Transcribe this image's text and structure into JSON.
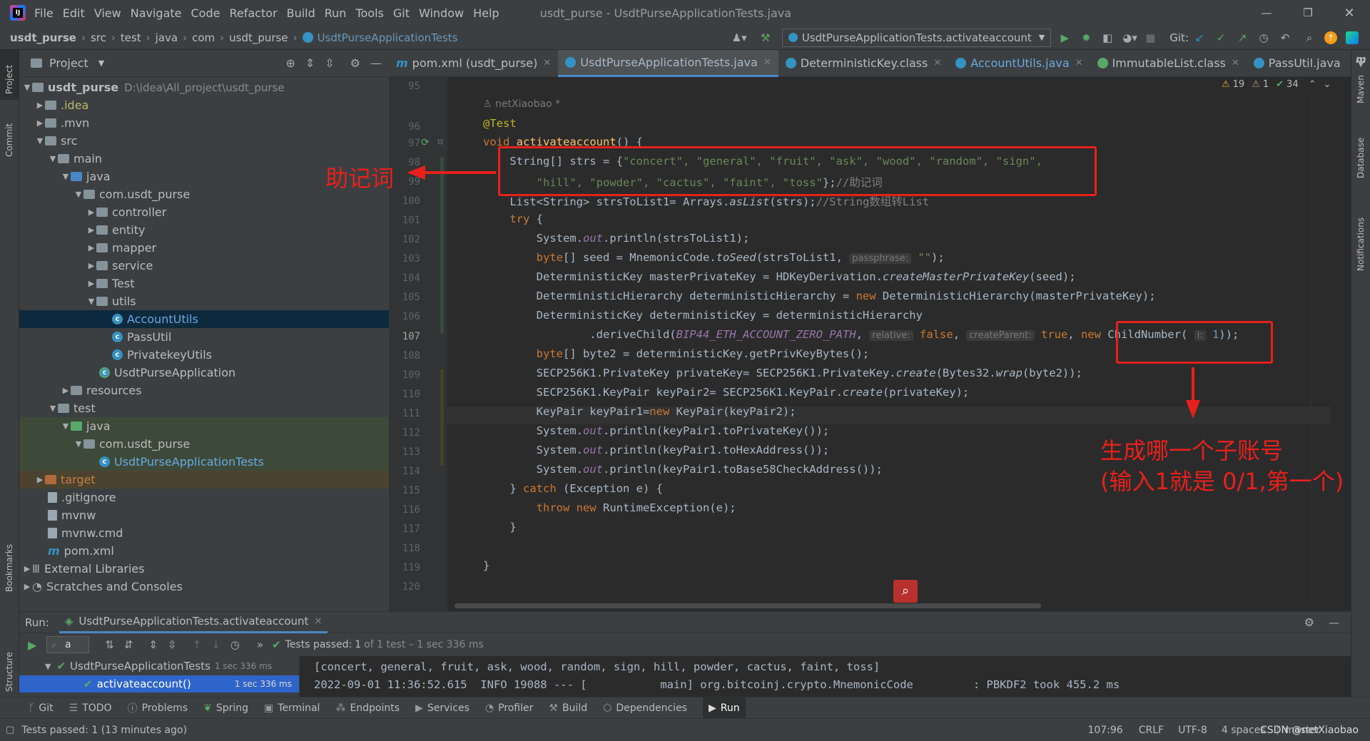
{
  "window": {
    "title": "usdt_purse - UsdtPurseApplicationTests.java"
  },
  "menu": [
    "File",
    "Edit",
    "View",
    "Navigate",
    "Code",
    "Refactor",
    "Build",
    "Run",
    "Tools",
    "Git",
    "Window",
    "Help"
  ],
  "breadcrumb": [
    "usdt_purse",
    "src",
    "test",
    "java",
    "com",
    "usdt_purse",
    "UsdtPurseApplicationTests"
  ],
  "run_config": "UsdtPurseApplicationTests.activateaccount",
  "git_label": "Git:",
  "left_strip": {
    "project": "Project",
    "commit": "Commit",
    "bookmarks": "Bookmarks",
    "structure": "Structure"
  },
  "right_strip": {
    "maven": "Maven",
    "database": "Database",
    "notifications": "Notifications"
  },
  "project_panel": {
    "title": "Project",
    "tree": [
      {
        "label": "usdt_purse",
        "extra": "D:\\idea\\All_project\\usdt_purse"
      },
      {
        "label": ".idea"
      },
      {
        "label": ".mvn"
      },
      {
        "label": "src"
      },
      {
        "label": "main"
      },
      {
        "label": "java"
      },
      {
        "label": "com.usdt_purse"
      },
      {
        "label": "controller"
      },
      {
        "label": "entity"
      },
      {
        "label": "mapper"
      },
      {
        "label": "service"
      },
      {
        "label": "Test"
      },
      {
        "label": "utils"
      },
      {
        "label": "AccountUtils"
      },
      {
        "label": "PassUtil"
      },
      {
        "label": "PrivatekeyUtils"
      },
      {
        "label": "UsdtPurseApplication"
      },
      {
        "label": "resources"
      },
      {
        "label": "test"
      },
      {
        "label": "java"
      },
      {
        "label": "com.usdt_purse"
      },
      {
        "label": "UsdtPurseApplicationTests"
      },
      {
        "label": "target"
      },
      {
        "label": ".gitignore"
      },
      {
        "label": "mvnw"
      },
      {
        "label": "mvnw.cmd"
      },
      {
        "label": "pom.xml"
      },
      {
        "label": "External Libraries"
      },
      {
        "label": "Scratches and Consoles"
      }
    ]
  },
  "editor_tabs": [
    {
      "label": "pom.xml (usdt_purse)"
    },
    {
      "label": "UsdtPurseApplicationTests.java"
    },
    {
      "label": "DeterministicKey.class"
    },
    {
      "label": "AccountUtils.java"
    },
    {
      "label": "ImmutableList.class"
    },
    {
      "label": "PassUtil.java"
    }
  ],
  "inspection": {
    "warnings": "19",
    "weak": "1",
    "ok": "34"
  },
  "line_numbers": [
    "95",
    "96",
    "97",
    "98",
    "99",
    "100",
    "101",
    "102",
    "103",
    "104",
    "105",
    "106",
    "107",
    "108",
    "109",
    "110",
    "111",
    "112",
    "113",
    "114",
    "115",
    "116",
    "117",
    "118",
    "119",
    "120"
  ],
  "code": {
    "author": "netXiaobao *",
    "l96": "@Test",
    "l97a": "void ",
    "l97b": "activateaccount",
    "l97c": "() {",
    "l98a": "    String[] ",
    "l98b": "strs",
    "l98c": " = {",
    "l98d": "\"concert\", \"general\", \"fruit\", \"ask\", \"wood\", \"random\", \"sign\",",
    "l99a": "        \"hill\", \"powder\", \"cactus\", \"faint\", \"toss\"",
    "l99b": "};",
    "l99c": "//助记词",
    "l100a": "    List<String> ",
    "l100b": "strsToList1",
    "l100c": "= Arrays.",
    "l100d": "asList",
    "l100e": "(strs);",
    "l100f": "//String数组转List",
    "l101a": "    ",
    "l101b": "try",
    "l101c": " {",
    "l102a": "        System.",
    "l102b": "out",
    "l102c": ".println(strsToList1);",
    "l103a": "        ",
    "l103b": "byte",
    "l103c": "[] seed = MnemonicCode.",
    "l103d": "toSeed",
    "l103e": "(strsToList1, ",
    "l103f": "passphrase:",
    "l103g": " \"\"",
    "l103h": ");",
    "l104a": "        DeterministicKey masterPrivateKey = HDKeyDerivation.",
    "l104b": "createMasterPrivateKey",
    "l104c": "(seed);",
    "l105a": "        DeterministicHierarchy deterministicHierarchy = ",
    "l105b": "new",
    "l105c": " DeterministicHierarchy(masterPrivateKey);",
    "l106": "        DeterministicKey deterministicKey = deterministicHierarchy",
    "l107a": "                .deriveChild(",
    "l107b": "BIP44_ETH_ACCOUNT_ZERO_PATH",
    "l107c": ", ",
    "l107d": "relative:",
    "l107e": " false",
    "l107f": ", ",
    "l107g": "createParent:",
    "l107h": " true",
    "l107i": ", ",
    "l107j": "new",
    "l107k": " ChildNumber( ",
    "l107l": "i:",
    "l107m": " 1",
    "l107n": "));",
    "l108a": "        ",
    "l108b": "byte",
    "l108c": "[] byte2 = deterministicKey.getPrivKeyBytes();",
    "l109a": "        SECP256K1.PrivateKey privateKey= SECP256K1.PrivateKey.",
    "l109b": "create",
    "l109c": "(Bytes32.",
    "l109d": "wrap",
    "l109e": "(byte2));",
    "l110a": "        SECP256K1.KeyPair keyPair2= SECP256K1.KeyPair.",
    "l110b": "create",
    "l110c": "(privateKey);",
    "l111a": "        KeyPair keyPair1=",
    "l111b": "new",
    "l111c": " KeyPair(keyPair2);",
    "l112a": "        System.",
    "l112b": "out",
    "l112c": ".println(keyPair1.toPrivateKey());",
    "l113a": "        System.",
    "l113b": "out",
    "l113c": ".println(keyPair1.toHexAddress());",
    "l114a": "        System.",
    "l114b": "out",
    "l114c": ".println(keyPair1.toBase58CheckAddress());",
    "l115a": "    } ",
    "l115b": "catch",
    "l115c": " (Exception e) {",
    "l116a": "        ",
    "l116b": "throw new",
    "l116c": " RuntimeException(e);",
    "l117": "    }",
    "l119": "}"
  },
  "annotations": {
    "mnemonic": "助记词",
    "account_line1": "生成哪一个子账号",
    "account_line2": "(输入1就是 0/1,第一个)"
  },
  "run_panel": {
    "run_label": "Run:",
    "tab": "UsdtPurseApplicationTests.activateaccount",
    "search_value": "a",
    "tests_passed": "Tests passed:",
    "tests_count": "1",
    "tests_detail": "of 1 test – 1 sec 336 ms",
    "tree_root": "UsdtPurseApplicationTests",
    "tree_root_time": "1 sec 336 ms",
    "tree_child": "activateaccount()",
    "tree_child_time": "1 sec 336 ms",
    "console_line1": "[concert, general, fruit, ask, wood, random, sign, hill, powder, cactus, faint, toss]",
    "console_line2": "2022-09-01 11:36:52.615  INFO 19088 --- [           main] org.bitcoinj.crypto.MnemonicCode         : PBKDF2 took 455.2 ms"
  },
  "bottom_tools": [
    "Git",
    "TODO",
    "Problems",
    "Spring",
    "Terminal",
    "Endpoints",
    "Services",
    "Profiler",
    "Build",
    "Dependencies",
    "Run"
  ],
  "status": {
    "message": "Tests passed: 1 (13 minutes ago)",
    "position": "107:96",
    "line_sep": "CRLF",
    "encoding": "UTF-8",
    "indent": "4 spaces",
    "branch": "master",
    "watermark": "CSDN @netXiaobao"
  }
}
